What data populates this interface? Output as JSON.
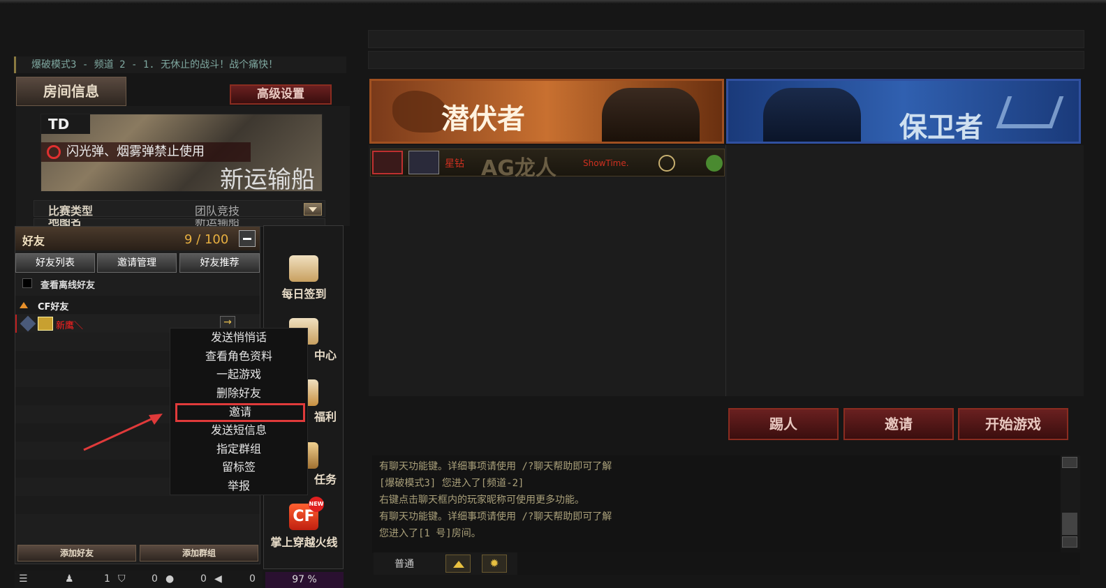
{
  "channel_banner": "爆破模式3 - 频道 2 - 1. 无休止的战斗！战个痛快！",
  "room_info_tab": "房间信息",
  "advanced_settings": "高级设置",
  "map": {
    "mode_tag": "TD",
    "notice": "闪光弹、烟雾弹禁止使用",
    "name": "新运输船"
  },
  "settings": [
    {
      "label": "比赛类型",
      "value": "团队竞技"
    },
    {
      "label": "地图名",
      "value": "新运输船"
    }
  ],
  "friends": {
    "title": "好友",
    "count": "9 / 100",
    "tabs": [
      "好友列表",
      "邀请管理",
      "好友推荐"
    ],
    "show_offline": "查看离线好友",
    "group": "CF好友",
    "friend_name": "新鹰＼",
    "add_friend": "添加好友",
    "add_group": "添加群组"
  },
  "context_menu": {
    "items": [
      "发送悄悄话",
      "查看角色资料",
      "一起游戏",
      "删除好友",
      "邀请",
      "发送短信息",
      "指定群组",
      "留标签",
      "举报"
    ],
    "highlighted_index": 4
  },
  "side_menu": [
    {
      "label": "每日签到",
      "icon": "calendar-check-icon"
    },
    {
      "label": "中心",
      "icon": "gift-icon"
    },
    {
      "label": "福利",
      "icon": "wings-badge-icon"
    },
    {
      "label": "任务",
      "icon": "task-badge-icon"
    },
    {
      "label": "掌上穿越火线",
      "icon": "cf-mobile-icon",
      "badge": "NEW"
    }
  ],
  "teams": {
    "left": "潜伏者",
    "right": "保卫者"
  },
  "player": {
    "prefix": "星钻",
    "clan": "AG龙人",
    "name": "ShowTime."
  },
  "actions": {
    "kick": "踢人",
    "invite": "邀请",
    "start": "开始游戏"
  },
  "chat_lines": [
    "有聊天功能键。详细事项请使用 /?聊天帮助即可了解",
    "[爆破模式3] 您进入了[频道-2]",
    "右键点击聊天框内的玩家昵称可使用更多功能。",
    "有聊天功能键。详细事项请使用 /?聊天帮助即可了解",
    "您进入了[1 号]房间。"
  ],
  "chat_input": {
    "mode": "普通"
  },
  "status_bar": {
    "players": "1",
    "v1": "0",
    "v2": "0",
    "v3": "0",
    "percent": "97 %"
  },
  "colors": {
    "accent_gold": "#e8b040",
    "player_red": "#d03020",
    "highlight_red": "#e03a3a"
  }
}
